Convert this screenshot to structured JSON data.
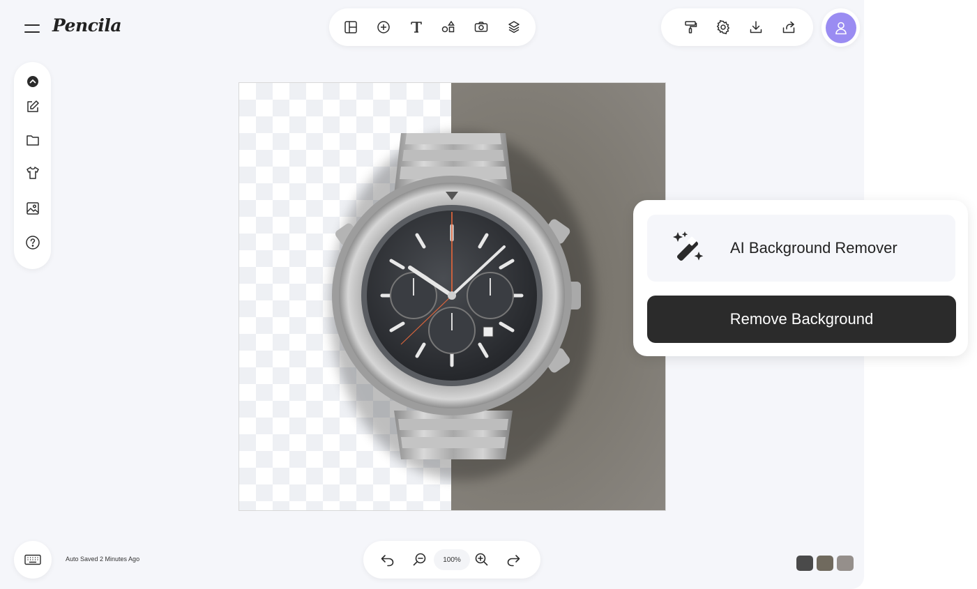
{
  "brand": {
    "name": "Pencila"
  },
  "toolbar": {
    "tools": [
      {
        "icon": "layout-icon"
      },
      {
        "icon": "add-circle-icon"
      },
      {
        "icon": "text-icon"
      },
      {
        "icon": "shapes-icon"
      },
      {
        "icon": "camera-icon"
      },
      {
        "icon": "layers-icon"
      }
    ]
  },
  "actions": {
    "items": [
      {
        "icon": "paint-roller-icon"
      },
      {
        "icon": "gear-icon"
      },
      {
        "icon": "download-icon"
      },
      {
        "icon": "share-icon"
      }
    ]
  },
  "user": {
    "avatar_color": "#9a8cf2",
    "icon": "user-icon"
  },
  "sidebar": {
    "items": [
      {
        "icon": "collapse-icon"
      },
      {
        "icon": "edit-icon"
      },
      {
        "icon": "folder-icon"
      },
      {
        "icon": "tshirt-icon"
      },
      {
        "icon": "image-icon"
      },
      {
        "icon": "help-icon"
      }
    ]
  },
  "canvas": {
    "image": "wristwatch-photo",
    "backdrop_color": "#7b776f",
    "transparent_pattern": "checkerboard"
  },
  "ai_panel": {
    "feature_icon": "magic-wand-icon",
    "title": "AI Background Remover",
    "button_label": "Remove Background"
  },
  "footer": {
    "autosave_text": "Auto Saved 2 Minutes Ago",
    "zoom_level": "100%",
    "zoom_controls": [
      "undo-icon",
      "zoom-out-icon",
      "zoom-in-icon",
      "redo-icon"
    ]
  },
  "palette": {
    "swatches": [
      "#4a4a4a",
      "#706a5e",
      "#958f8b"
    ]
  }
}
